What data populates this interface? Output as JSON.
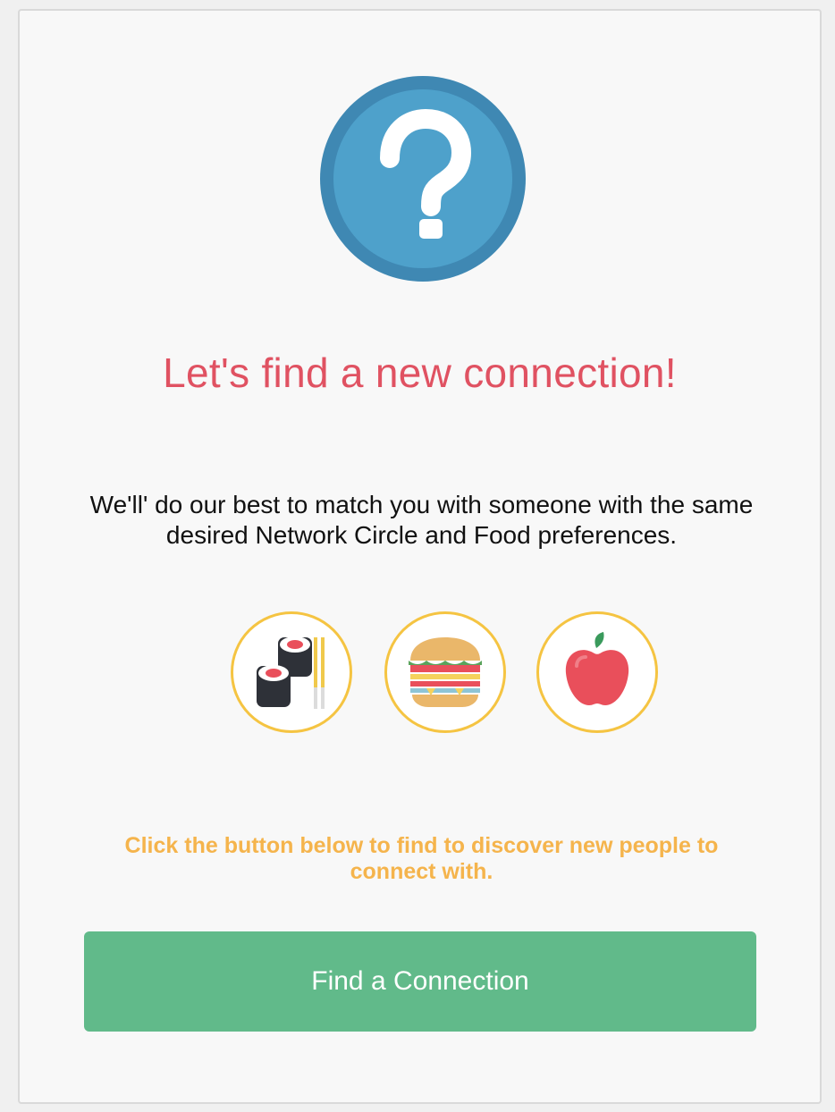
{
  "hero": {
    "icon": "question-mark-icon"
  },
  "title": "Let's find a new connection!",
  "description": "We'll' do our best to match you with someone with the same desired Network Circle and Food preferences.",
  "food_icons": [
    {
      "icon": "sushi-icon"
    },
    {
      "icon": "burger-icon"
    },
    {
      "icon": "apple-icon"
    }
  ],
  "hint": "Click the button below to find to discover new people to connect with.",
  "button": {
    "label": "Find a Connection"
  },
  "colors": {
    "title": "#e05262",
    "hint": "#f5b44c",
    "button": "#61ba8a",
    "hero_blue": "#4ea1cb",
    "circle_border": "#f5c442"
  }
}
